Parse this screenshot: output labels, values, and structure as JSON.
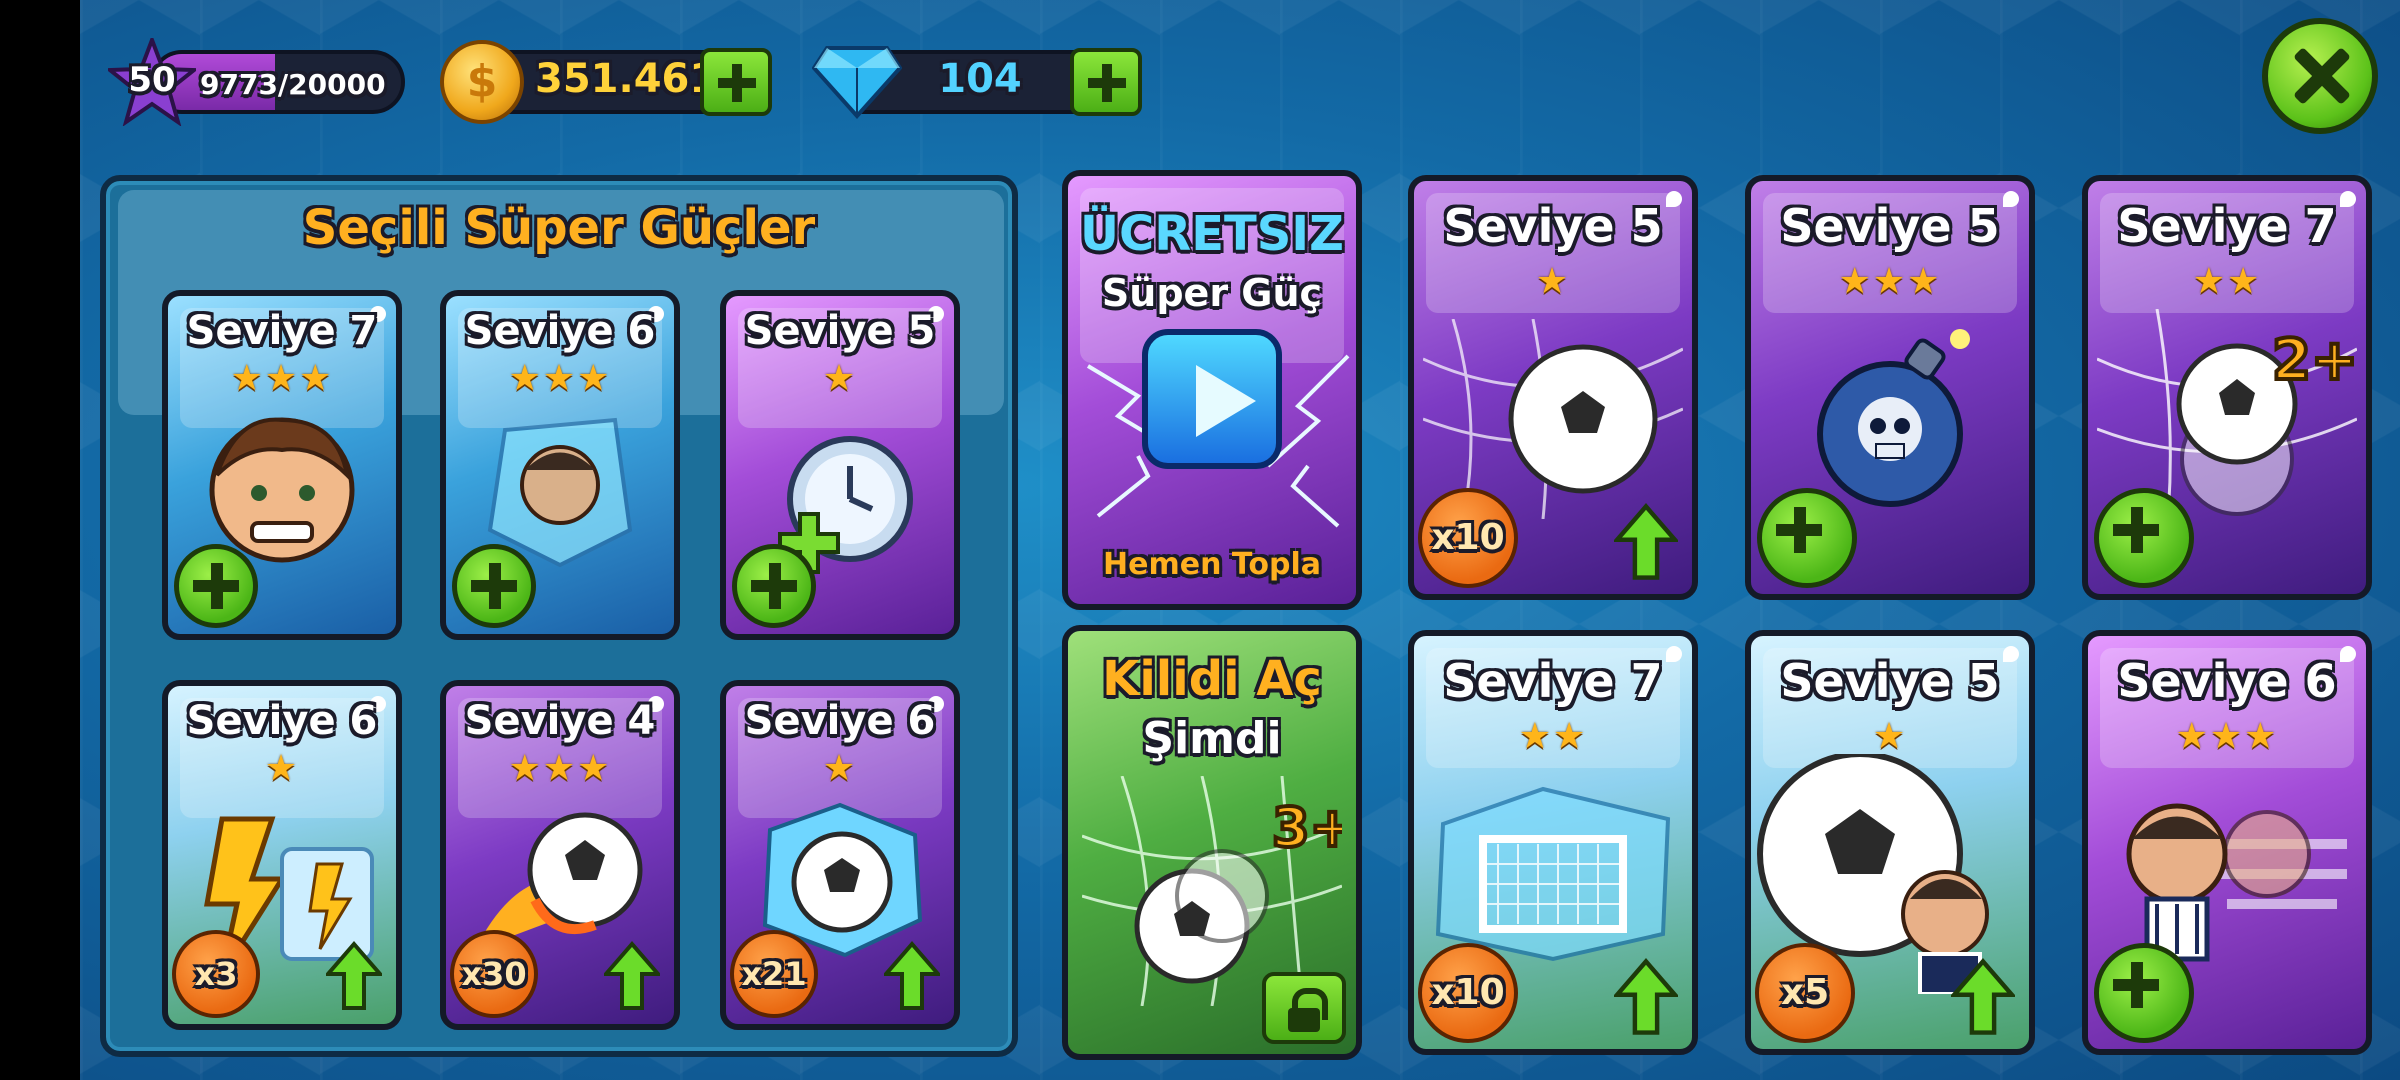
{
  "topbar": {
    "level": "50",
    "xp_text": "9773/20000",
    "xp_progress": 0.4887,
    "coins": "351.461",
    "gems": "104"
  },
  "selected_panel": {
    "title": "Seçili Süper Güçler",
    "cards": [
      {
        "level": "Seviye 7",
        "stars": "★★★",
        "icon": "player-head-icon",
        "badge": "add"
      },
      {
        "level": "Seviye 6",
        "stars": "★★★",
        "icon": "frozen-player-icon",
        "badge": "add"
      },
      {
        "level": "Seviye 5",
        "stars": "★",
        "icon": "clock-plus-icon",
        "badge": "add"
      },
      {
        "level": "Seviye 6",
        "stars": "★",
        "icon": "lightning-icon",
        "count": "x3"
      },
      {
        "level": "Seviye 4",
        "stars": "★★★",
        "icon": "fireball-icon",
        "count": "x30"
      },
      {
        "level": "Seviye 6",
        "stars": "★",
        "icon": "frozen-ball-icon",
        "count": "x21"
      }
    ]
  },
  "free_card": {
    "title": "ÜCRETSIZ",
    "subtitle": "Süper Güç",
    "bottom": "Hemen Topla"
  },
  "unlock_card": {
    "title": "Kilidi Aç",
    "subtitle": "Şimdi",
    "multiplier": "3+"
  },
  "shop_cards": [
    {
      "level": "Seviye 5",
      "stars": "★",
      "icon": "ball-net-icon",
      "count": "x10"
    },
    {
      "level": "Seviye 5",
      "stars": "★★★",
      "icon": "skull-bomb-icon",
      "badge": "add"
    },
    {
      "level": "Seviye 7",
      "stars": "★★",
      "icon": "double-ball-icon",
      "badge": "add",
      "multiplier": "2+"
    },
    {
      "level": "Seviye 7",
      "stars": "★★",
      "icon": "frozen-goal-icon",
      "count": "x10"
    },
    {
      "level": "Seviye 5",
      "stars": "★",
      "icon": "big-ball-icon",
      "count": "x5"
    },
    {
      "level": "Seviye 6",
      "stars": "★★★",
      "icon": "speed-player-icon",
      "badge": "add"
    }
  ],
  "colors": {
    "accent_orange": "#ffb020",
    "accent_green": "#5cc21a",
    "gem_blue": "#53d3ff"
  }
}
